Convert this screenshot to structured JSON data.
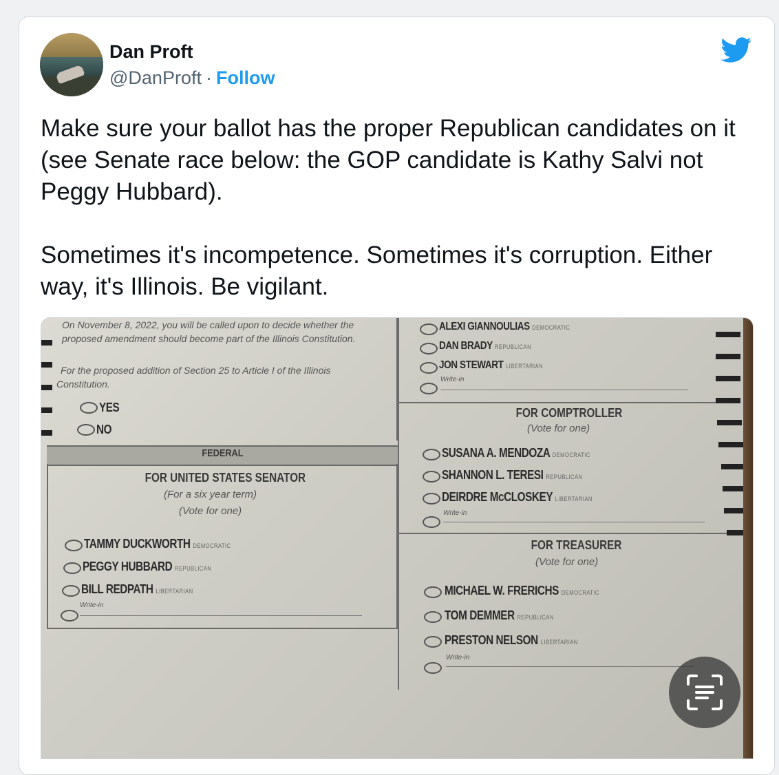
{
  "author": {
    "name": "Dan Proft",
    "handle": "@DanProft",
    "separator": "·",
    "follow_label": "Follow"
  },
  "tweet": {
    "paragraph1": "Make sure your ballot has the proper Republican candidates on it (see Senate race below: the GOP candidate is Kathy Salvi not Peggy Hubbard).",
    "paragraph2": "Sometimes it's incompetence. Sometimes it's corruption. Either way, it's Illinois. Be vigilant."
  },
  "icons": {
    "brand": "twitter-bird-icon",
    "scan": "text-scan-icon"
  },
  "colors": {
    "accent": "#1d9bf0",
    "text": "#0f1419",
    "muted": "#536471"
  },
  "ballot": {
    "amendment_line1": "On November 8, 2022, you will be called upon to decide whether the",
    "amendment_line2": "proposed amendment should become part of the Illinois Constitution.",
    "amendment_line3": "For the proposed addition of Section 25 to Article I of the Illinois",
    "amendment_line4": "Constitution.",
    "yes": "YES",
    "no": "NO",
    "federal": "FEDERAL",
    "senator_title": "FOR UNITED STATES SENATOR",
    "senator_term": "(For a six year term)",
    "vote_for_one": "(Vote for one)",
    "write_in": "Write-in",
    "senate_candidates": [
      {
        "name": "TAMMY DUCKWORTH",
        "party": "DEMOCRATIC"
      },
      {
        "name": "PEGGY HUBBARD",
        "party": "REPUBLICAN"
      },
      {
        "name": "BILL REDPATH",
        "party": "LIBERTARIAN"
      }
    ],
    "top_right_candidates": [
      {
        "name": "ALEXI GIANNOULIAS",
        "party": "DEMOCRATIC"
      },
      {
        "name": "DAN BRADY",
        "party": "REPUBLICAN"
      },
      {
        "name": "JON STEWART",
        "party": "LIBERTARIAN"
      }
    ],
    "comptroller_title": "FOR COMPTROLLER",
    "comptroller_candidates": [
      {
        "name": "SUSANA A. MENDOZA",
        "party": "DEMOCRATIC"
      },
      {
        "name": "SHANNON L. TERESI",
        "party": "REPUBLICAN"
      },
      {
        "name": "DEIRDRE McCLOSKEY",
        "party": "LIBERTARIAN"
      }
    ],
    "treasurer_title": "FOR TREASURER",
    "treasurer_candidates": [
      {
        "name": "MICHAEL W. FRERICHS",
        "party": "DEMOCRATIC"
      },
      {
        "name": "TOM DEMMER",
        "party": "REPUBLICAN"
      },
      {
        "name": "PRESTON NELSON",
        "party": "LIBERTARIAN"
      }
    ]
  }
}
